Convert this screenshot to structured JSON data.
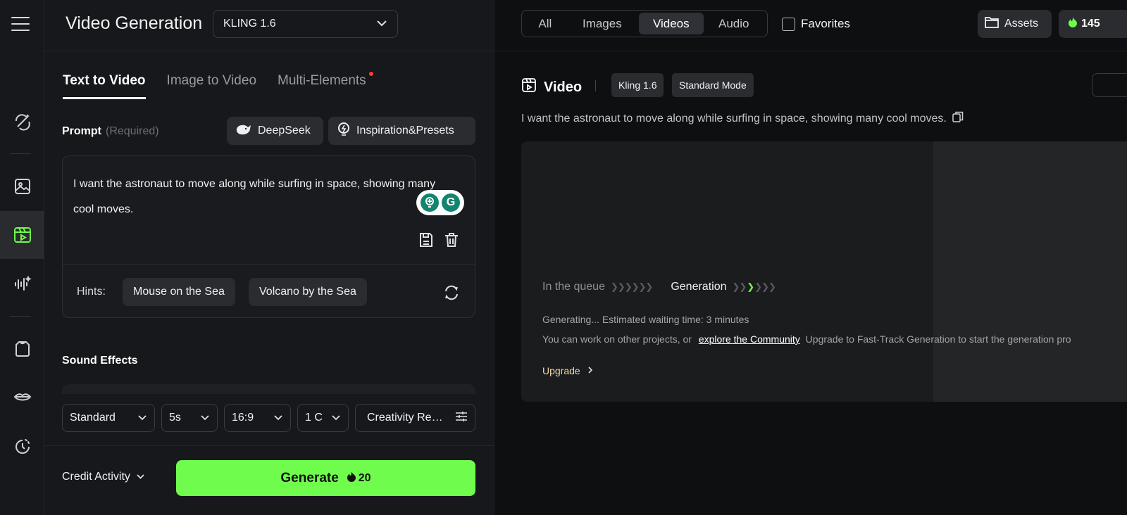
{
  "sidebar": {
    "icons": [
      "menu-icon",
      "magic-icon",
      "image-icon",
      "video-icon",
      "audio-icon",
      "outfit-icon",
      "lips-icon",
      "history-icon"
    ]
  },
  "header": {
    "title": "Video Generation",
    "model": "KLING 1.6"
  },
  "tabs": [
    {
      "label": "Text to Video",
      "active": true
    },
    {
      "label": "Image to Video",
      "active": false
    },
    {
      "label": "Multi-Elements",
      "active": false,
      "badge": true
    }
  ],
  "prompt": {
    "label": "Prompt",
    "required": "(Required)",
    "deepseek": "DeepSeek",
    "inspiration": "Inspiration&Presets",
    "text": "I want the astronaut to move along while surfing in space, showing many cool moves."
  },
  "hints": {
    "label": "Hints:",
    "items": [
      "Mouse on the Sea",
      "Volcano by the Sea"
    ]
  },
  "sound": {
    "label": "Sound Effects"
  },
  "settings": {
    "mode": "Standard",
    "duration": "5s",
    "ratio": "16:9",
    "count": "1 C",
    "creativity": "Creativity Re…"
  },
  "footer": {
    "credit_activity": "Credit Activity",
    "generate": "Generate",
    "cost": "20"
  },
  "right": {
    "filters": [
      {
        "label": "All",
        "active": false
      },
      {
        "label": "Images",
        "active": false
      },
      {
        "label": "Videos",
        "active": true
      },
      {
        "label": "Audio",
        "active": false
      }
    ],
    "favorites": "Favorites",
    "assets": "Assets",
    "credits": "145",
    "video_title": "Video",
    "tags": [
      "Kling 1.6",
      "Standard Mode"
    ],
    "prompt": "I want the astronaut to move along while surfing in space, showing many cool moves.",
    "queue_label": "In the queue",
    "generation_label": "Generation",
    "generating_text": "Generating... Estimated waiting time: 3 minutes",
    "work_text": "You can work on other projects, or",
    "community_link": "explore the Community",
    "fasttrack_text": "Upgrade to Fast-Track Generation to start the generation pro",
    "upgrade": "Upgrade"
  },
  "colors": {
    "accent": "#6ffc4d",
    "badge": "#ff3b3b",
    "upgrade": "#f3d9a8"
  }
}
